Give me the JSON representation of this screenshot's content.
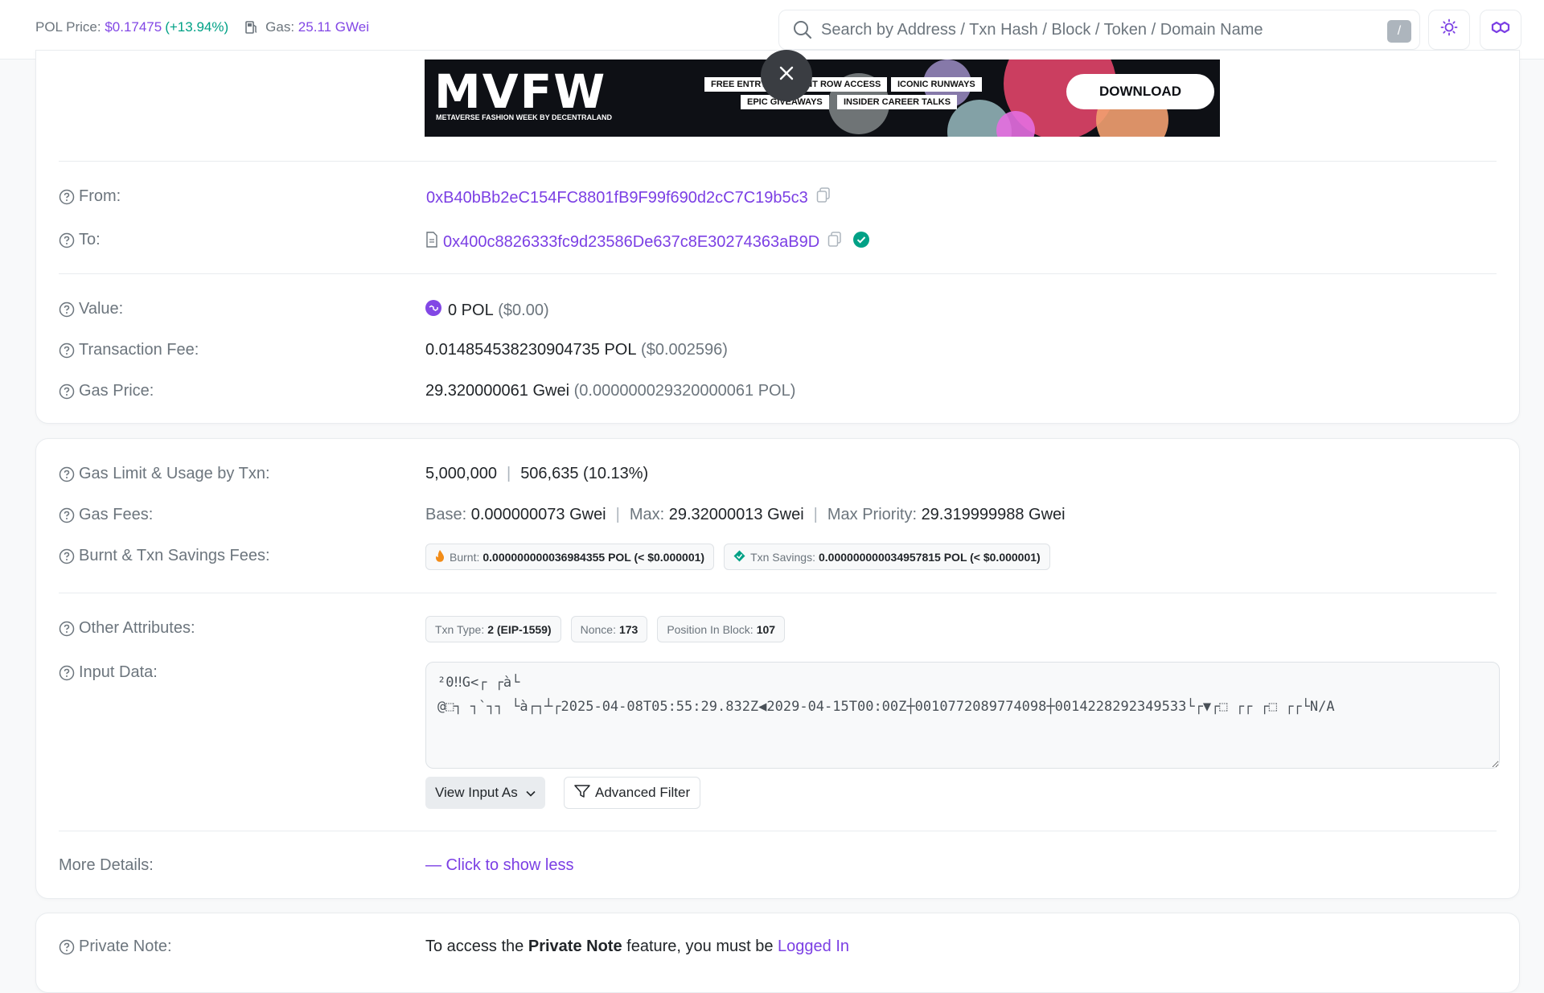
{
  "header": {
    "pol_price_label": "POL Price:",
    "pol_price": "$0.17475",
    "pol_change": "(+13.94%)",
    "gas_label": "Gas:",
    "gas_value": "25.11 GWei",
    "search_placeholder": "Search by Address / Txn Hash / Block / Token / Domain Name",
    "search_shortcut": "/"
  },
  "banner": {
    "logo_text": "MVFW",
    "subtitle": "METAVERSE FASHION WEEK BY DECENTRALAND",
    "tags": [
      "FREE ENTRY",
      "FRONT ROW ACCESS",
      "ICONIC RUNWAYS",
      "EPIC GIVEAWAYS",
      "INSIDER CAREER TALKS"
    ],
    "cta": "DOWNLOAD"
  },
  "tx": {
    "from_label": "From:",
    "from_address": "0xB40bBb2eC154FC8801fB9F99f690d2cC7C19b5c3",
    "to_label": "To:",
    "to_address": "0x400c8826333fc9d23586De637c8E30274363aB9D",
    "value_label": "Value:",
    "value_amount": "0 POL",
    "value_usd": "($0.00)",
    "fee_label": "Transaction Fee:",
    "fee_amount": "0.014854538230904735 POL",
    "fee_usd": "($0.002596)",
    "gas_price_label": "Gas Price:",
    "gas_price_gwei": "29.320000061 Gwei",
    "gas_price_pol": "(0.000000029320000061 POL)"
  },
  "details": {
    "gas_limit_label": "Gas Limit & Usage by Txn:",
    "gas_limit": "5,000,000",
    "gas_used": "506,635 (10.13%)",
    "gas_fees_label": "Gas Fees:",
    "base_label": "Base:",
    "base_value": "0.000000073 Gwei",
    "max_label": "Max:",
    "max_value": "29.32000013 Gwei",
    "max_priority_label": "Max Priority:",
    "max_priority_value": "29.319999988 Gwei",
    "burnt_label": "Burnt & Txn Savings Fees:",
    "burnt_chip_label": "Burnt:",
    "burnt_chip_value": "0.000000000036984355 POL (< $0.000001)",
    "savings_chip_label": "Txn Savings:",
    "savings_chip_value": "0.000000000034957815 POL (< $0.000001)",
    "other_label": "Other Attributes:",
    "txn_type_label": "Txn Type:",
    "txn_type_value": "2 (EIP-1559)",
    "nonce_label": "Nonce:",
    "nonce_value": "173",
    "position_label": "Position In Block:",
    "position_value": "107",
    "input_label": "Input Data:",
    "input_data": "²0‼G<┌ ┌à└\n@⬚┐ ┐`┐┐ └à┌┐┴┌2025-04-08T05:55:29.832Z◀2029-04-15T00:00Z┼0010772089774098┼0014228292349533└┌▼┌⬚ ┌┌ ┌⬚ ┌┌└N/A",
    "view_input_as": "View Input As",
    "advanced_filter": "Advanced Filter",
    "more_details_label": "More Details:",
    "show_less": "— Click to show less"
  },
  "private_note": {
    "label": "Private Note:",
    "text_before": "To access the",
    "bold": "Private Note",
    "text_after": "feature, you must be",
    "link": "Logged In"
  },
  "colors": {
    "accent": "#7b3fe4",
    "green": "#00a186",
    "muted": "#6c757d"
  }
}
